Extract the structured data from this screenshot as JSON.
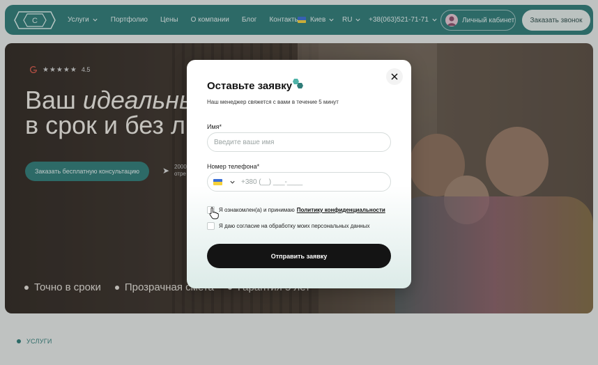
{
  "header": {
    "nav": [
      {
        "label": "Услуги",
        "has_dropdown": true
      },
      {
        "label": "Портфолио",
        "has_dropdown": false
      },
      {
        "label": "Цены",
        "has_dropdown": false
      },
      {
        "label": "О компании",
        "has_dropdown": false
      },
      {
        "label": "Блог",
        "has_dropdown": false
      },
      {
        "label": "Контакты",
        "has_dropdown": false
      }
    ],
    "city": "Киев",
    "language": "RU",
    "phone": "+38(063)521-71-71",
    "cabinet_label": "Личный кабинет",
    "call_button": "Заказать звонок",
    "accent_color": "#2f7c78"
  },
  "hero": {
    "rating": "4.5",
    "title_line1_plain": "Ваш ",
    "title_line1_italic": "идеальны",
    "title_line2": "в срок и без л",
    "consult_button": "Заказать бесплатную консультацию",
    "review_text_1": "2000",
    "review_text_2": "отре",
    "features": [
      "Точно в сроки",
      "Прозрачная смета",
      "Гарантия 5 лет"
    ]
  },
  "section_label": "УСЛУГИ",
  "modal": {
    "title": "Оставьте заявку",
    "subtitle": "Наш менеджер свяжется с вами в течение 5 минут",
    "name_label": "Имя*",
    "name_placeholder": "Введите ваше имя",
    "phone_label": "Номер телефона*",
    "phone_placeholder": "+380 (__) ___-____",
    "consent_1_prefix": "Я ознакомлен(а) и принимаю",
    "consent_1_link": "Политику конфиденциальности",
    "consent_2": "Я даю согласие на обработку моих персональных данных",
    "submit_button": "Отправить заявку"
  }
}
